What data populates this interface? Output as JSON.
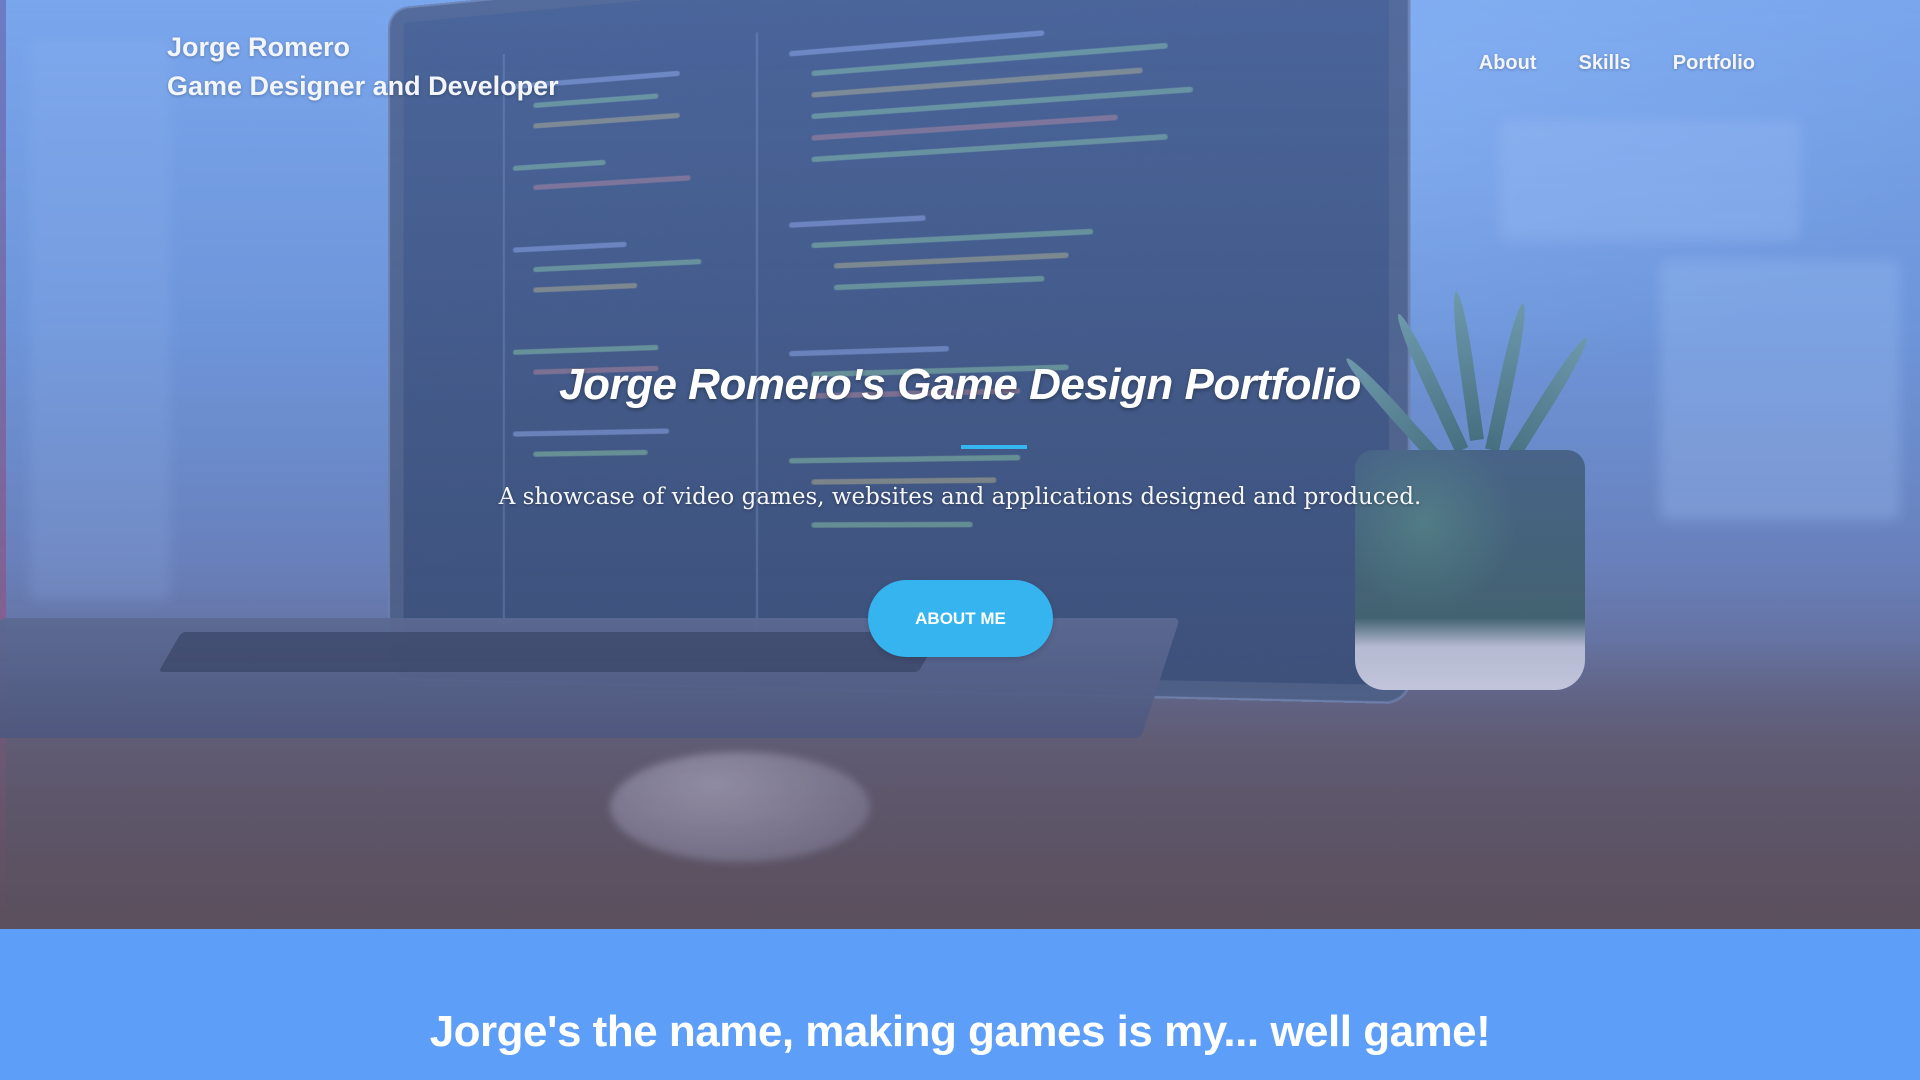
{
  "header": {
    "name": "Jorge Romero",
    "tagline": "Game Designer and Developer",
    "nav": [
      {
        "label": "About"
      },
      {
        "label": "Skills"
      },
      {
        "label": "Portfolio"
      }
    ]
  },
  "hero": {
    "title": "Jorge Romero's Game Design Portfolio",
    "subtitle": "A showcase of video games, websites and applications designed and produced.",
    "cta_label": "ABOUT ME",
    "background": "laptop-with-code-photo"
  },
  "about": {
    "heading": "Jorge's the name, making games is my... well game!"
  },
  "colors": {
    "accent": "#36b4ef",
    "band": "#5c9ef8",
    "text": "#ffffff"
  }
}
